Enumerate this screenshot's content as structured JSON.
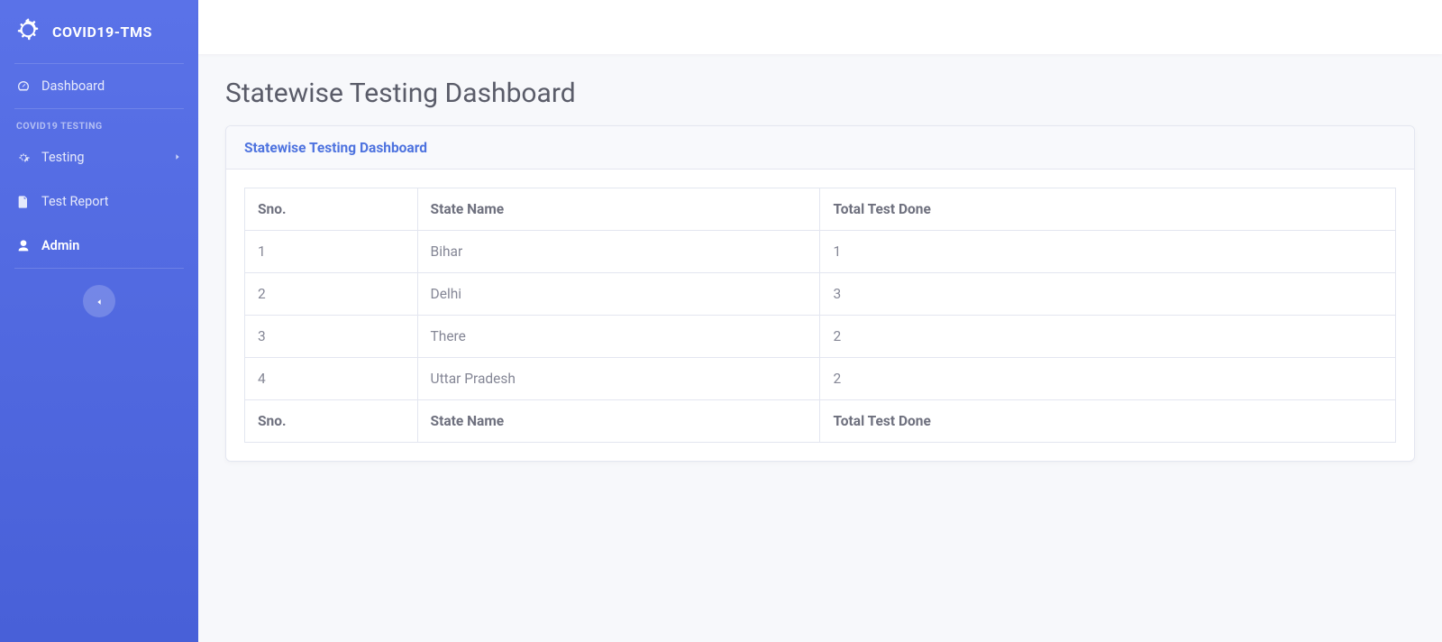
{
  "brand": {
    "text": "COVID19-TMS"
  },
  "sidebar": {
    "items": [
      {
        "label": "Dashboard",
        "icon": "dashboard"
      },
      {
        "label": "Testing",
        "icon": "gear",
        "hasChevron": true
      },
      {
        "label": "Test Report",
        "icon": "file"
      },
      {
        "label": "Admin",
        "icon": "user",
        "active": true
      }
    ],
    "heading": "COVID19 TESTING"
  },
  "page": {
    "title": "Statewise Testing Dashboard",
    "card_title": "Statewise Testing Dashboard"
  },
  "table": {
    "columns": [
      "Sno.",
      "State Name",
      "Total Test Done"
    ],
    "rows": [
      {
        "sno": "1",
        "state": "Bihar",
        "total": "1"
      },
      {
        "sno": "2",
        "state": "Delhi",
        "total": "3"
      },
      {
        "sno": "3",
        "state": "There",
        "total": "2"
      },
      {
        "sno": "4",
        "state": "Uttar Pradesh",
        "total": "2"
      }
    ],
    "footer": [
      "Sno.",
      "State Name",
      "Total Test Done"
    ]
  }
}
